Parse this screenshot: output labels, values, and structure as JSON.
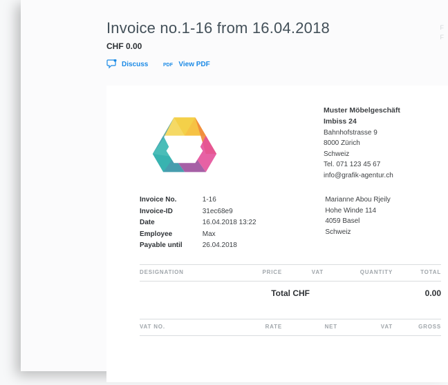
{
  "header": {
    "title": "Invoice no.1-16 from 16.04.2018",
    "amount": "CHF 0.00",
    "actions": {
      "discuss": "Discuss",
      "view_pdf": "View PDF"
    }
  },
  "side_faint": {
    "line1": "F",
    "line2": "F"
  },
  "company": {
    "name": "Muster Möbelgeschäft",
    "name2": "Imbiss 24",
    "street": "Bahnhofstrasse 9",
    "city": "8000 Zürich",
    "country": "Schweiz",
    "tel": "Tel. 071 123 45 67",
    "email": "info@grafik-agentur.ch"
  },
  "invoice_meta": {
    "labels": {
      "no": "Invoice No.",
      "id": "Invoice-ID",
      "date": "Date",
      "employee": "Employee",
      "payable": "Payable until"
    },
    "values": {
      "no": "1-16",
      "id": "31ec68e9",
      "date": "16.04.2018 13:22",
      "employee": "Max",
      "payable": "26.04.2018"
    }
  },
  "recipient": {
    "name": "Marianne Abou Rjeily",
    "street": "Hohe Winde 114",
    "city": "4059 Basel",
    "country": "Schweiz"
  },
  "table": {
    "headers": {
      "designation": "DESIGNATION",
      "price": "PRICE",
      "vat": "VAT",
      "quantity": "QUANTITY",
      "total": "TOTAL"
    },
    "total_label": "Total CHF",
    "total_value": "0.00"
  },
  "vat_table": {
    "no": "VAT NO.",
    "rate": "RATE",
    "net": "NET",
    "vat": "VAT",
    "gross": "GROSS"
  }
}
